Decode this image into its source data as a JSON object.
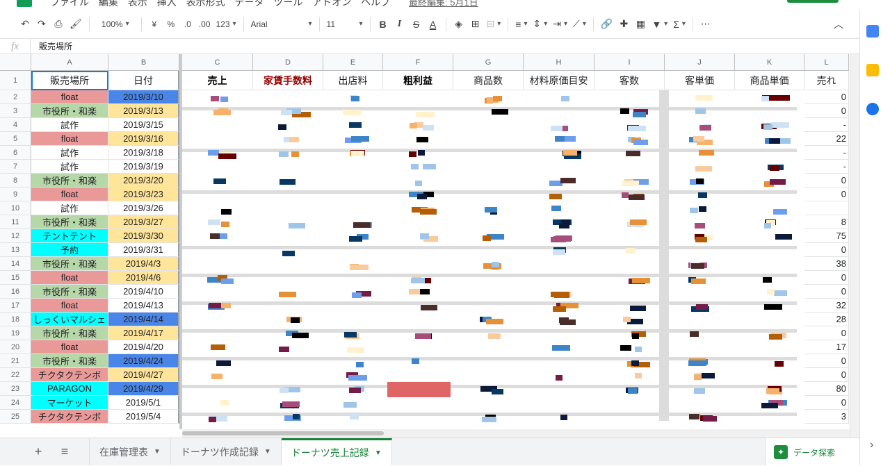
{
  "menu": {
    "items": [
      "ファイル",
      "編集",
      "表示",
      "挿入",
      "表示形式",
      "データ",
      "ツール",
      "アドオン",
      "ヘルプ"
    ],
    "last_edit": "最終編集: 5月1日"
  },
  "toolbar": {
    "zoom": "100%",
    "currency": "¥",
    "percent": "%",
    "dec_less": ".0",
    "dec_more": ".00",
    "format": "123",
    "font": "Arial",
    "font_size": "11",
    "bold": "B",
    "italic": "I",
    "strike": "S",
    "textcolor": "A"
  },
  "formula_bar": {
    "fx": "fx",
    "value": "販売場所"
  },
  "columns": [
    "A",
    "B",
    "C",
    "D",
    "E",
    "F",
    "G",
    "H",
    "I",
    "J",
    "K",
    "L"
  ],
  "headers": [
    "販売場所",
    "日付",
    "売上",
    "家賃手数料",
    "出店料",
    "粗利益",
    "商品数",
    "材料原価目安",
    "客数",
    "客単価",
    "商品単価",
    "売れ"
  ],
  "rows": [
    {
      "n": "2",
      "place": "float",
      "date": "2019/3/10",
      "l": "0"
    },
    {
      "n": "3",
      "place": "市役所・和楽",
      "date": "2019/3/13",
      "l": "0"
    },
    {
      "n": "4",
      "place": "試作",
      "date": "2019/3/15",
      "l": "-"
    },
    {
      "n": "5",
      "place": "float",
      "date": "2019/3/16",
      "l": "22"
    },
    {
      "n": "6",
      "place": "試作",
      "date": "2019/3/18",
      "l": "-"
    },
    {
      "n": "7",
      "place": "試作",
      "date": "2019/3/19",
      "l": "-"
    },
    {
      "n": "8",
      "place": "市役所・和楽",
      "date": "2019/3/20",
      "l": "0"
    },
    {
      "n": "9",
      "place": "float",
      "date": "2019/3/23",
      "l": "0"
    },
    {
      "n": "10",
      "place": "試作",
      "date": "2019/3/26",
      "l": ""
    },
    {
      "n": "11",
      "place": "市役所・和楽",
      "date": "2019/3/27",
      "l": "8"
    },
    {
      "n": "12",
      "place": "テントテント",
      "date": "2019/3/30",
      "l": "75"
    },
    {
      "n": "13",
      "place": "予約",
      "date": "2019/3/31",
      "l": "0"
    },
    {
      "n": "14",
      "place": "市役所・和楽",
      "date": "2019/4/3",
      "l": "38"
    },
    {
      "n": "15",
      "place": "float",
      "date": "2019/4/6",
      "l": "0"
    },
    {
      "n": "16",
      "place": "市役所・和楽",
      "date": "2019/4/10",
      "l": "0"
    },
    {
      "n": "17",
      "place": "float",
      "date": "2019/4/13",
      "l": "32"
    },
    {
      "n": "18",
      "place": "しっくいマルシェ",
      "date": "2019/4/14",
      "l": "28"
    },
    {
      "n": "19",
      "place": "市役所・和楽",
      "date": "2019/4/17",
      "l": "0"
    },
    {
      "n": "20",
      "place": "float",
      "date": "2019/4/20",
      "l": "17"
    },
    {
      "n": "21",
      "place": "市役所・和楽",
      "date": "2019/4/24",
      "l": "0"
    },
    {
      "n": "22",
      "place": "チクタクテンボ",
      "date": "2019/4/27",
      "l": "0"
    },
    {
      "n": "23",
      "place": "PARAGON",
      "date": "2019/4/29",
      "l": "80"
    },
    {
      "n": "24",
      "place": "マーケット",
      "date": "2019/5/1",
      "l": "0"
    },
    {
      "n": "25",
      "place": "チクタクテンボ",
      "date": "2019/5/4",
      "l": "3"
    }
  ],
  "place_colors": {
    "float": "#ea9999",
    "市役所・和楽": "#b6d7a8",
    "試作": "#ffffff",
    "テントテント": "#00ffff",
    "予約": "#00ffff",
    "しっくいマルシェ": "#00ffff",
    "チクタクテンボ": "#ea9999",
    "PARAGON": "#00ffff",
    "マーケット": "#00ffff"
  },
  "date_colors": [
    "#4a86e8",
    "#ffe599",
    "#ffffff",
    "#ffe599",
    "#ffffff",
    "#ffffff",
    "#ffe599",
    "#ffe599",
    "#ffffff",
    "#ffe599",
    "#ffe599",
    "#ffffff",
    "#ffe599",
    "#ffe599",
    "#ffffff",
    "#ffffff",
    "#4a86e8",
    "#ffe599",
    "#ffffff",
    "#4a86e8",
    "#ffe599",
    "#4a86e8",
    "#ffffff",
    "#ffffff"
  ],
  "sheets": {
    "tabs": [
      "在庫管理表",
      "ドーナツ作成記録",
      "ドーナツ売上記録"
    ],
    "active": 2,
    "explore": "データ探索"
  },
  "icons": [
    "undo-icon",
    "redo-icon",
    "print-icon",
    "paint-format-icon",
    "fill-color-icon",
    "borders-icon",
    "merge-icon",
    "align-icon",
    "valign-icon",
    "wrap-icon",
    "rotate-icon",
    "link-icon",
    "comment-icon",
    "chart-icon",
    "filter-icon",
    "function-icon",
    "more-icon",
    "collapse-icon",
    "add-sheet-icon",
    "sheet-list-icon",
    "calendar-icon",
    "keep-icon",
    "tasks-icon",
    "expand-panel-icon"
  ]
}
